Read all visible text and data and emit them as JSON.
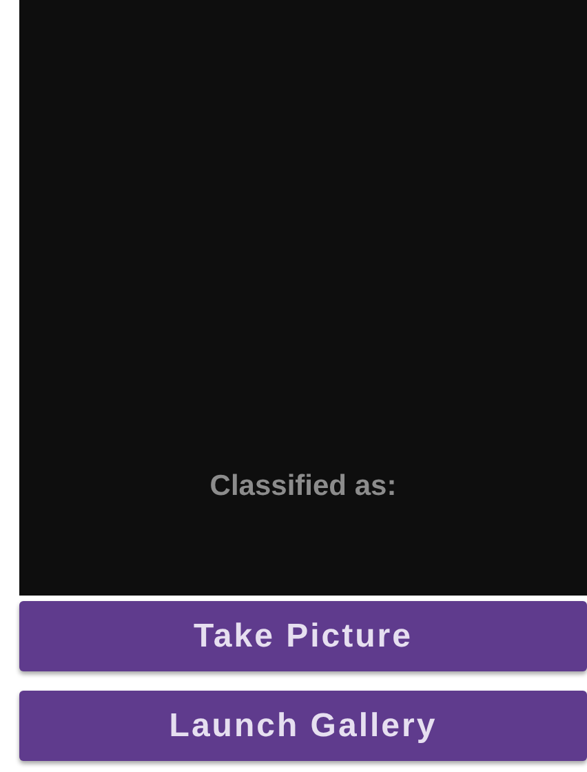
{
  "result": {
    "label": "Classified as:"
  },
  "buttons": [
    {
      "label": "Take Picture"
    },
    {
      "label": "Launch Gallery"
    }
  ]
}
